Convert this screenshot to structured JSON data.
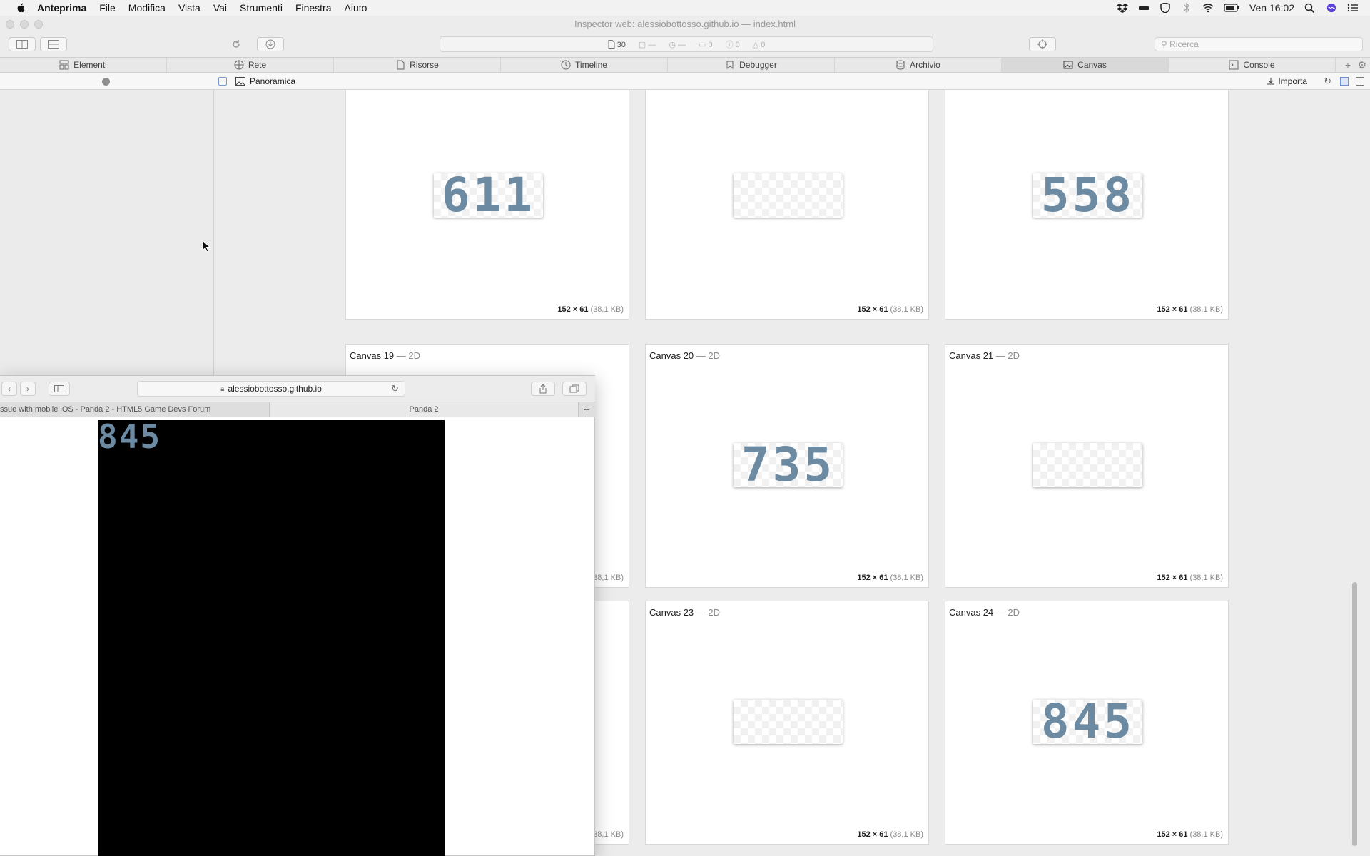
{
  "menubar": {
    "app": "Anteprima",
    "items": [
      "File",
      "Modifica",
      "Vista",
      "Vai",
      "Strumenti",
      "Finestra",
      "Aiuto"
    ],
    "clock": "Ven 16:02",
    "tray_icons": [
      "dropbox-icon",
      "battery-bar-icon",
      "shield-icon",
      "bluetooth-icon",
      "wifi-icon",
      "battery-icon",
      "spotlight-icon",
      "siri-icon",
      "list-icon"
    ]
  },
  "inspector": {
    "title": "Inspector web: alessiobottosso.github.io — index.html",
    "resources_count": "30",
    "activity_placeholders": [
      "—",
      "—",
      "0",
      "0",
      "0"
    ],
    "search_placeholder": "Ricerca",
    "tabs": [
      {
        "label": "Elementi",
        "icon": "elements-icon"
      },
      {
        "label": "Rete",
        "icon": "network-icon"
      },
      {
        "label": "Risorse",
        "icon": "resources-icon"
      },
      {
        "label": "Timeline",
        "icon": "timeline-icon"
      },
      {
        "label": "Debugger",
        "icon": "debugger-icon"
      },
      {
        "label": "Archivio",
        "icon": "storage-icon"
      },
      {
        "label": "Canvas",
        "icon": "canvas-icon",
        "active": true
      },
      {
        "label": "Console",
        "icon": "console-icon"
      }
    ],
    "subbar": {
      "overview": "Panoramica",
      "import": "Importa"
    }
  },
  "canvases": [
    {
      "name": "",
      "type": "",
      "value": "611",
      "dims": "152 × 61",
      "kb": "(38,1 KB)"
    },
    {
      "name": "",
      "type": "",
      "value": "",
      "dims": "152 × 61",
      "kb": "(38,1 KB)"
    },
    {
      "name": "",
      "type": "",
      "value": "558",
      "dims": "152 × 61",
      "kb": "(38,1 KB)"
    },
    {
      "name": "Canvas 19",
      "type": "— 2D",
      "value": "",
      "dims": "",
      "kb": "38,1 KB)"
    },
    {
      "name": "Canvas 20",
      "type": "— 2D",
      "value": "735",
      "dims": "152 × 61",
      "kb": "(38,1 KB)"
    },
    {
      "name": "Canvas 21",
      "type": "— 2D",
      "value": "",
      "dims": "152 × 61",
      "kb": "(38,1 KB)"
    },
    {
      "name": "",
      "type": "",
      "value": "",
      "dims": "",
      "kb": "38,1 KB)"
    },
    {
      "name": "Canvas 23",
      "type": "— 2D",
      "value": "",
      "dims": "152 × 61",
      "kb": "(38,1 KB)"
    },
    {
      "name": "Canvas 24",
      "type": "— 2D",
      "value": "845",
      "dims": "152 × 61",
      "kb": "(38,1 KB)"
    }
  ],
  "safari": {
    "url": "alessiobottosso.github.io",
    "tab1": "ssue with mobile iOS - Panda 2 - HTML5 Game Devs Forum",
    "tab2": "Panda 2",
    "game_score": "845"
  },
  "colors": {
    "digit": "#6c8ba3",
    "game_bg": "#000000"
  }
}
